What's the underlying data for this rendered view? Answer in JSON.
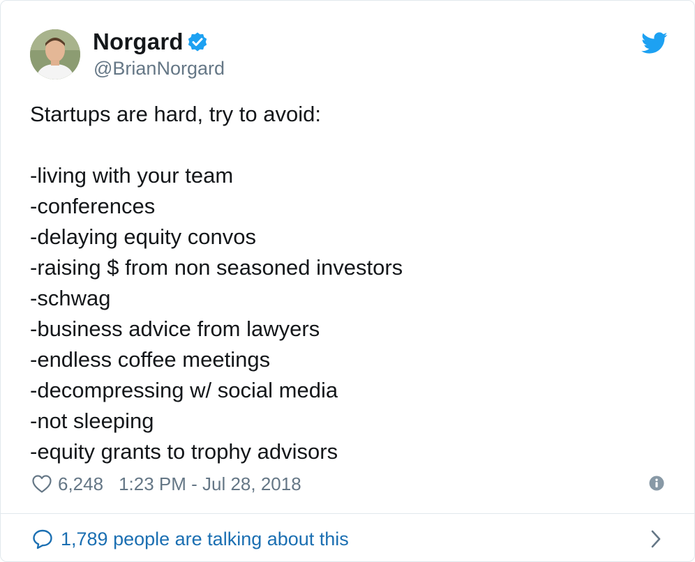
{
  "author": {
    "name": "Norgard",
    "handle": "@BrianNorgard",
    "verified": true
  },
  "tweet": {
    "lines": [
      "Startups are hard, try to avoid:",
      "",
      "-living with your team",
      "-conferences",
      "-delaying equity convos",
      "-raising $ from non seasoned investors",
      "-schwag",
      "-business advice from lawyers",
      "-endless coffee meetings",
      "-decompressing w/ social media",
      "-not sleeping",
      "-equity grants to trophy advisors"
    ],
    "likes": "6,248",
    "timestamp": "1:23 PM - Jul 28, 2018"
  },
  "footer": {
    "talking_label": "1,789 people are talking about this"
  },
  "icons": {
    "verified": "verified-badge-icon",
    "brand": "twitter-bird-icon",
    "like": "heart-icon",
    "info": "info-icon",
    "reply": "speech-bubble-icon",
    "chevron": "chevron-right-icon"
  },
  "colors": {
    "text": "#14171a",
    "secondary": "#657786",
    "twitter_blue": "#1da1f2",
    "link_blue": "#1b6fb2",
    "border": "#e1e8ed"
  }
}
